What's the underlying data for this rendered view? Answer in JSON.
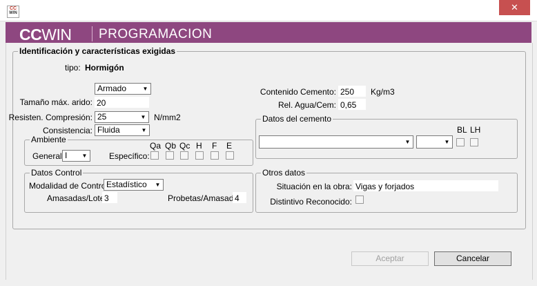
{
  "window": {
    "close_glyph": "✕"
  },
  "banner": {
    "logo_bold": "CC",
    "logo_light": "WIN",
    "module": "PROGRAMACION"
  },
  "ident": {
    "title": "Identificación y características exigidas",
    "tipo_label": "tipo:",
    "tipo_value": "Hormigón",
    "armado_value": "Armado",
    "tamano_label": "Tamaño máx. arido:",
    "tamano_value": "20",
    "resist_label": "Resisten. Compresión:",
    "resist_value": "25",
    "resist_unit": "N/mm2",
    "consist_label": "Consistencia:",
    "consist_value": "Fluida",
    "contenido_label": "Contenido Cemento:",
    "contenido_value": "250",
    "contenido_unit": "Kg/m3",
    "agua_label": "Rel. Agua/Cem:",
    "agua_value": "0,65"
  },
  "ambiente": {
    "title": "Ambiente",
    "general_label": "General:",
    "general_value": "I",
    "especifico_label": "Específico:",
    "cols": [
      "Qa",
      "Qb",
      "Qc",
      "H",
      "F",
      "E"
    ]
  },
  "cemento": {
    "title": "Datos del cemento",
    "type_value": "",
    "class_value": "",
    "bl_label": "BL",
    "lh_label": "LH"
  },
  "control": {
    "title": "Datos Control",
    "modalidad_label": "Modalidad de Control:",
    "modalidad_value": "Estadístico",
    "amasadas_label": "Amasadas/Lote:",
    "amasadas_value": "3",
    "probetas_label": "Probetas/Amasada:",
    "probetas_value": "4"
  },
  "otros": {
    "title": "Otros datos",
    "situacion_label": "Situación en la obra:",
    "situacion_value": "Vigas y forjados",
    "distintivo_label": "Distintivo Reconocido:"
  },
  "buttons": {
    "aceptar": "Aceptar",
    "cancelar": "Cancelar"
  },
  "icons": {
    "dropdown": "▼"
  }
}
